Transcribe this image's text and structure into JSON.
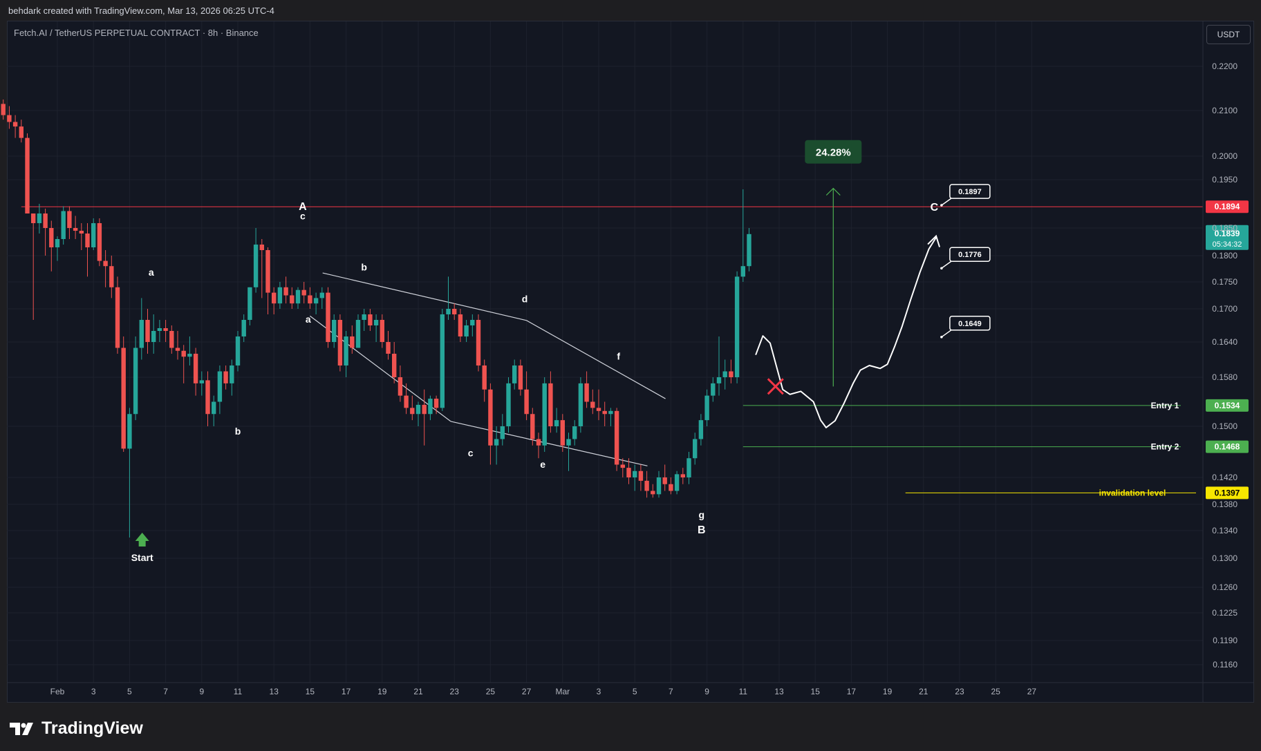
{
  "header": {
    "attribution": "behdark created with TradingView.com, Mar 13, 2026 06:25 UTC-4"
  },
  "symbol": {
    "title": "Fetch.AI / TetherUS PERPETUAL CONTRACT · 8h · Binance"
  },
  "currency_button": "USDT",
  "footer": {
    "brand": "TradingView"
  },
  "colors": {
    "background": "#131722",
    "up": "#26a69a",
    "down": "#ef5350",
    "grid": "#1e222d",
    "resistance": "#f23645",
    "entry": "#4caf50",
    "invalidation": "#f7e600",
    "annotation": "#ffffff"
  },
  "chart_data": {
    "type": "candlestick",
    "timeframe": "8h",
    "y_axis": {
      "ticks": [
        0.22,
        0.21,
        0.2,
        0.195,
        0.185,
        0.18,
        0.175,
        0.17,
        0.164,
        0.158,
        0.15,
        0.142,
        0.138,
        0.134,
        0.13,
        0.126,
        0.1225,
        0.119,
        0.116
      ],
      "tick_labels": [
        "0.2200",
        "0.2100",
        "0.2000",
        "0.1950",
        "0.1850",
        "0.1800",
        "0.1750",
        "0.1700",
        "0.1640",
        "0.1580",
        "0.1500",
        "0.1420",
        "0.1380",
        "0.1340",
        "0.1300",
        "0.1260",
        "0.1225",
        "0.1190",
        "0.1160"
      ],
      "range": [
        0.114,
        0.226
      ]
    },
    "x_axis": {
      "start": "2026-01-29",
      "end": "2026-02-28",
      "ticks": [
        {
          "date": "2026-02-01",
          "label": "Feb"
        },
        {
          "date": "2026-02-03",
          "label": "3"
        },
        {
          "date": "2026-02-05",
          "label": "5"
        },
        {
          "date": "2026-02-07",
          "label": "7"
        },
        {
          "date": "2026-02-09",
          "label": "9"
        },
        {
          "date": "2026-02-11",
          "label": "11"
        },
        {
          "date": "2026-02-13",
          "label": "13"
        },
        {
          "date": "2026-02-15",
          "label": "15"
        },
        {
          "date": "2026-02-17",
          "label": "17"
        },
        {
          "date": "2026-02-19",
          "label": "19"
        },
        {
          "date": "2026-02-21",
          "label": "21"
        },
        {
          "date": "2026-02-23",
          "label": "23"
        },
        {
          "date": "2026-02-25",
          "label": "25"
        },
        {
          "date": "2026-02-27",
          "label": "27"
        },
        {
          "date": "2026-03-01",
          "label": "Mar"
        },
        {
          "date": "2026-03-03",
          "label": "3"
        },
        {
          "date": "2026-03-05",
          "label": "5"
        },
        {
          "date": "2026-03-07",
          "label": "7"
        },
        {
          "date": "2026-03-09",
          "label": "9"
        },
        {
          "date": "2026-03-11",
          "label": "11"
        },
        {
          "date": "2026-03-13",
          "label": "13"
        },
        {
          "date": "2026-03-15",
          "label": "15"
        },
        {
          "date": "2026-03-17",
          "label": "17"
        },
        {
          "date": "2026-03-19",
          "label": "19"
        },
        {
          "date": "2026-03-21",
          "label": "21"
        },
        {
          "date": "2026-03-23",
          "label": "23"
        },
        {
          "date": "2026-03-25",
          "label": "25"
        },
        {
          "date": "2026-03-27",
          "label": "27"
        }
      ]
    },
    "price_levels": [
      {
        "label": "0.1894",
        "price": 0.1894,
        "kind": "resistance",
        "line_from": "2026-01-30"
      },
      {
        "label": "0.1534",
        "price": 0.1534,
        "kind": "entry",
        "name": "Entry 1",
        "line_from": "2026-03-11"
      },
      {
        "label": "0.1468",
        "price": 0.1468,
        "kind": "entry",
        "name": "Entry 2",
        "line_from": "2026-03-11"
      },
      {
        "label": "0.1397",
        "price": 0.1397,
        "kind": "invalidation",
        "name": "invalidation level",
        "line_from": "2026-03-20"
      }
    ],
    "last_price": {
      "label": "0.1839",
      "countdown": "05:34:32",
      "price": 0.1839
    },
    "targets": [
      {
        "label": "0.1897",
        "date": "2026-03-22",
        "price": 0.1897
      },
      {
        "label": "0.1776",
        "date": "2026-03-22",
        "price": 0.1776
      },
      {
        "label": "0.1649",
        "date": "2026-03-22",
        "price": 0.1649
      }
    ],
    "projection_percent": {
      "label": "24.28%",
      "date": "2026-03-16",
      "from_price": 0.1565,
      "to_price": 0.1932,
      "box_price": 0.2008
    },
    "invalid_mark": {
      "date": "2026-03-12.8",
      "price": 0.1565
    },
    "wave_labels": [
      {
        "text": "Start",
        "date": "2026-02-05.7",
        "price": 0.1296,
        "bold": true
      },
      {
        "text": "a",
        "date": "2026-02-06.2",
        "price": 0.1762
      },
      {
        "text": "b",
        "date": "2026-02-11",
        "price": 0.1487
      },
      {
        "text": "A",
        "date": "2026-02-14.6",
        "price": 0.1887
      },
      {
        "text": "c",
        "date": "2026-02-14.6",
        "price": 0.1868
      },
      {
        "text": "a",
        "date": "2026-02-14.9",
        "price": 0.1675
      },
      {
        "text": "b",
        "date": "2026-02-18",
        "price": 0.1772
      },
      {
        "text": "c",
        "date": "2026-02-23.9",
        "price": 0.1453
      },
      {
        "text": "d",
        "date": "2026-02-26.9",
        "price": 0.1712
      },
      {
        "text": "e",
        "date": "2026-02-27.9",
        "price": 0.1435
      },
      {
        "text": "f",
        "date": "2026-03-04.1",
        "price": 0.161
      },
      {
        "text": "g",
        "date": "2026-03-08.7",
        "price": 0.1359
      },
      {
        "text": "B",
        "date": "2026-03-08.7",
        "price": 0.1336
      },
      {
        "text": "C",
        "date": "2026-03-21.6",
        "price": 0.1886
      }
    ],
    "trendlines": [
      {
        "from": {
          "date": "2026-02-15.7",
          "price": 0.1767
        },
        "to": {
          "date": "2026-02-27",
          "price": 0.1679
        }
      },
      {
        "from": {
          "date": "2026-02-27",
          "price": 0.1679
        },
        "to": {
          "date": "2026-03-06.7",
          "price": 0.1545
        }
      },
      {
        "from": {
          "date": "2026-02-15",
          "price": 0.1687
        },
        "to": {
          "date": "2026-02-22.8",
          "price": 0.1508
        }
      },
      {
        "from": {
          "date": "2026-02-22.8",
          "price": 0.1508
        },
        "to": {
          "date": "2026-03-05.7",
          "price": 0.1438
        }
      }
    ],
    "projection_path": [
      {
        "date": "2026-03-11.7",
        "price": 0.1618
      },
      {
        "date": "2026-03-12.1",
        "price": 0.1651
      },
      {
        "date": "2026-03-12.5",
        "price": 0.1638
      },
      {
        "date": "2026-03-13.2",
        "price": 0.156
      },
      {
        "date": "2026-03-13.6",
        "price": 0.1552
      },
      {
        "date": "2026-03-14.2",
        "price": 0.1557
      },
      {
        "date": "2026-03-14.9",
        "price": 0.154
      },
      {
        "date": "2026-03-15.3",
        "price": 0.151
      },
      {
        "date": "2026-03-15.6",
        "price": 0.1498
      },
      {
        "date": "2026-03-16.1",
        "price": 0.1509
      },
      {
        "date": "2026-03-16.6",
        "price": 0.1538
      },
      {
        "date": "2026-03-17.1",
        "price": 0.157
      },
      {
        "date": "2026-03-17.5",
        "price": 0.1592
      },
      {
        "date": "2026-03-18",
        "price": 0.16
      },
      {
        "date": "2026-03-18.6",
        "price": 0.1595
      },
      {
        "date": "2026-03-19",
        "price": 0.1602
      },
      {
        "date": "2026-03-19.4",
        "price": 0.1632
      },
      {
        "date": "2026-03-19.8",
        "price": 0.1667
      },
      {
        "date": "2026-03-20.3",
        "price": 0.1718
      },
      {
        "date": "2026-03-20.8",
        "price": 0.1768
      },
      {
        "date": "2026-03-21.3",
        "price": 0.1812
      },
      {
        "date": "2026-03-21.7",
        "price": 0.1833
      }
    ],
    "candles": [
      [
        0.2115,
        0.2125,
        0.208,
        0.209
      ],
      [
        0.209,
        0.211,
        0.206,
        0.2075
      ],
      [
        0.2075,
        0.209,
        0.204,
        0.2065
      ],
      [
        0.2065,
        0.208,
        0.203,
        0.204
      ],
      [
        0.204,
        0.205,
        0.188,
        0.188
      ],
      [
        0.188,
        0.188,
        0.168,
        0.186
      ],
      [
        0.186,
        0.19,
        0.184,
        0.188
      ],
      [
        0.188,
        0.189,
        0.18,
        0.185
      ],
      [
        0.185,
        0.1865,
        0.177,
        0.1815
      ],
      [
        0.1815,
        0.1835,
        0.179,
        0.183
      ],
      [
        0.183,
        0.1895,
        0.182,
        0.1885
      ],
      [
        0.1885,
        0.1895,
        0.183,
        0.185
      ],
      [
        0.185,
        0.1875,
        0.183,
        0.1845
      ],
      [
        0.1845,
        0.186,
        0.181,
        0.184
      ],
      [
        0.184,
        0.186,
        0.176,
        0.1815
      ],
      [
        0.1815,
        0.187,
        0.181,
        0.186
      ],
      [
        0.186,
        0.187,
        0.178,
        0.179
      ],
      [
        0.179,
        0.181,
        0.174,
        0.178
      ],
      [
        0.178,
        0.18,
        0.172,
        0.174
      ],
      [
        0.174,
        0.176,
        0.162,
        0.163
      ],
      [
        0.163,
        0.165,
        0.146,
        0.1465
      ],
      [
        0.1465,
        0.153,
        0.133,
        0.152
      ],
      [
        0.152,
        0.165,
        0.151,
        0.163
      ],
      [
        0.163,
        0.172,
        0.161,
        0.168
      ],
      [
        0.168,
        0.17,
        0.162,
        0.164
      ],
      [
        0.164,
        0.169,
        0.162,
        0.166
      ],
      [
        0.166,
        0.168,
        0.164,
        0.1665
      ],
      [
        0.1665,
        0.168,
        0.164,
        0.166
      ],
      [
        0.166,
        0.167,
        0.162,
        0.163
      ],
      [
        0.163,
        0.166,
        0.161,
        0.1625
      ],
      [
        0.1625,
        0.1635,
        0.157,
        0.1615
      ],
      [
        0.1615,
        0.165,
        0.16,
        0.162
      ],
      [
        0.162,
        0.163,
        0.155,
        0.157
      ],
      [
        0.157,
        0.159,
        0.155,
        0.1575
      ],
      [
        0.1575,
        0.159,
        0.15,
        0.152
      ],
      [
        0.152,
        0.155,
        0.15,
        0.154
      ],
      [
        0.154,
        0.16,
        0.152,
        0.159
      ],
      [
        0.159,
        0.16,
        0.156,
        0.157
      ],
      [
        0.157,
        0.161,
        0.155,
        0.16
      ],
      [
        0.16,
        0.166,
        0.159,
        0.165
      ],
      [
        0.165,
        0.169,
        0.164,
        0.168
      ],
      [
        0.168,
        0.174,
        0.167,
        0.174
      ],
      [
        0.174,
        0.185,
        0.173,
        0.182
      ],
      [
        0.182,
        0.183,
        0.172,
        0.181
      ],
      [
        0.181,
        0.1815,
        0.169,
        0.173
      ],
      [
        0.173,
        0.174,
        0.169,
        0.171
      ],
      [
        0.171,
        0.175,
        0.17,
        0.174
      ],
      [
        0.174,
        0.176,
        0.171,
        0.1725
      ],
      [
        0.1725,
        0.174,
        0.17,
        0.171
      ],
      [
        0.171,
        0.174,
        0.17,
        0.1735
      ],
      [
        0.1735,
        0.175,
        0.171,
        0.1725
      ],
      [
        0.1725,
        0.174,
        0.17,
        0.171
      ],
      [
        0.171,
        0.173,
        0.169,
        0.172
      ],
      [
        0.172,
        0.174,
        0.17,
        0.173
      ],
      [
        0.173,
        0.174,
        0.163,
        0.164
      ],
      [
        0.164,
        0.169,
        0.163,
        0.168
      ],
      [
        0.168,
        0.169,
        0.159,
        0.16
      ],
      [
        0.16,
        0.166,
        0.158,
        0.165
      ],
      [
        0.165,
        0.167,
        0.162,
        0.163
      ],
      [
        0.163,
        0.169,
        0.163,
        0.168
      ],
      [
        0.168,
        0.17,
        0.166,
        0.169
      ],
      [
        0.169,
        0.17,
        0.166,
        0.167
      ],
      [
        0.167,
        0.169,
        0.164,
        0.168
      ],
      [
        0.168,
        0.169,
        0.163,
        0.164
      ],
      [
        0.164,
        0.166,
        0.161,
        0.162
      ],
      [
        0.162,
        0.164,
        0.157,
        0.158
      ],
      [
        0.158,
        0.16,
        0.154,
        0.155
      ],
      [
        0.155,
        0.157,
        0.152,
        0.153
      ],
      [
        0.153,
        0.155,
        0.151,
        0.152
      ],
      [
        0.152,
        0.154,
        0.15,
        0.1535
      ],
      [
        0.1535,
        0.156,
        0.147,
        0.152
      ],
      [
        0.152,
        0.155,
        0.151,
        0.1545
      ],
      [
        0.1545,
        0.155,
        0.152,
        0.153
      ],
      [
        0.153,
        0.17,
        0.1525,
        0.169
      ],
      [
        0.169,
        0.176,
        0.168,
        0.17
      ],
      [
        0.17,
        0.171,
        0.168,
        0.169
      ],
      [
        0.169,
        0.17,
        0.164,
        0.165
      ],
      [
        0.165,
        0.168,
        0.164,
        0.167
      ],
      [
        0.167,
        0.169,
        0.165,
        0.168
      ],
      [
        0.168,
        0.169,
        0.159,
        0.16
      ],
      [
        0.16,
        0.161,
        0.154,
        0.156
      ],
      [
        0.156,
        0.157,
        0.144,
        0.147
      ],
      [
        0.147,
        0.15,
        0.144,
        0.148
      ],
      [
        0.148,
        0.152,
        0.147,
        0.15
      ],
      [
        0.15,
        0.158,
        0.149,
        0.157
      ],
      [
        0.157,
        0.161,
        0.156,
        0.16
      ],
      [
        0.16,
        0.161,
        0.155,
        0.156
      ],
      [
        0.156,
        0.159,
        0.151,
        0.152
      ],
      [
        0.152,
        0.153,
        0.147,
        0.148
      ],
      [
        0.148,
        0.149,
        0.145,
        0.147
      ],
      [
        0.147,
        0.158,
        0.146,
        0.157
      ],
      [
        0.157,
        0.159,
        0.149,
        0.15
      ],
      [
        0.15,
        0.153,
        0.149,
        0.151
      ],
      [
        0.151,
        0.152,
        0.146,
        0.147
      ],
      [
        0.147,
        0.149,
        0.143,
        0.148
      ],
      [
        0.148,
        0.151,
        0.147,
        0.15
      ],
      [
        0.15,
        0.158,
        0.149,
        0.157
      ],
      [
        0.157,
        0.159,
        0.153,
        0.154
      ],
      [
        0.154,
        0.156,
        0.152,
        0.153
      ],
      [
        0.153,
        0.156,
        0.151,
        0.1525
      ],
      [
        0.1525,
        0.154,
        0.15,
        0.152
      ],
      [
        0.152,
        0.153,
        0.15,
        0.1525
      ],
      [
        0.1525,
        0.153,
        0.143,
        0.144
      ],
      [
        0.144,
        0.145,
        0.142,
        0.1435
      ],
      [
        0.1435,
        0.145,
        0.141,
        0.142
      ],
      [
        0.142,
        0.144,
        0.14,
        0.143
      ],
      [
        0.143,
        0.144,
        0.14,
        0.1415
      ],
      [
        0.1415,
        0.143,
        0.139,
        0.14
      ],
      [
        0.14,
        0.141,
        0.139,
        0.1395
      ],
      [
        0.1395,
        0.143,
        0.139,
        0.142
      ],
      [
        0.142,
        0.144,
        0.14,
        0.141
      ],
      [
        0.141,
        0.142,
        0.1395,
        0.14
      ],
      [
        0.14,
        0.143,
        0.1395,
        0.1425
      ],
      [
        0.1425,
        0.1435,
        0.141,
        0.142
      ],
      [
        0.142,
        0.146,
        0.141,
        0.145
      ],
      [
        0.145,
        0.149,
        0.144,
        0.148
      ],
      [
        0.148,
        0.152,
        0.147,
        0.151
      ],
      [
        0.151,
        0.156,
        0.15,
        0.155
      ],
      [
        0.155,
        0.158,
        0.154,
        0.157
      ],
      [
        0.157,
        0.165,
        0.155,
        0.158
      ],
      [
        0.158,
        0.161,
        0.156,
        0.159
      ],
      [
        0.159,
        0.161,
        0.157,
        0.158
      ],
      [
        0.158,
        0.177,
        0.157,
        0.176
      ],
      [
        0.176,
        0.193,
        0.175,
        0.178
      ],
      [
        0.178,
        0.185,
        0.177,
        0.1839
      ]
    ]
  }
}
